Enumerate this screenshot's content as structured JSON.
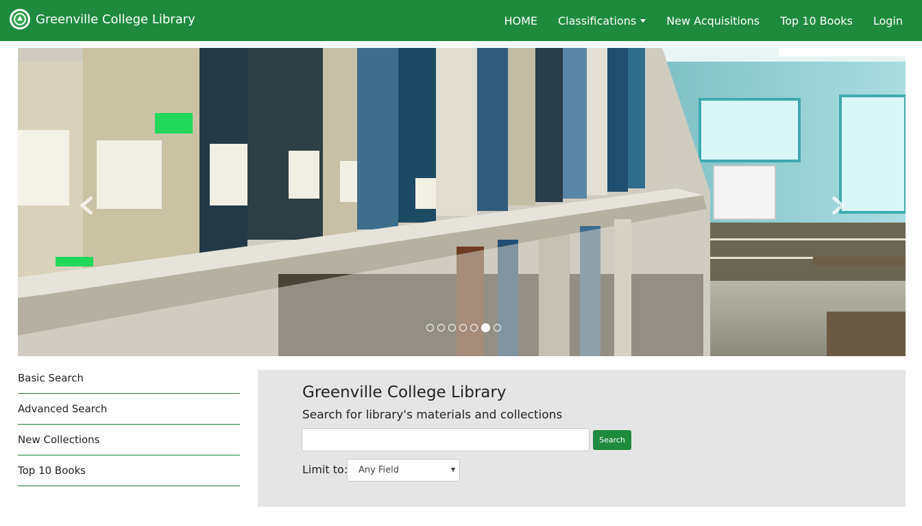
{
  "navbar": {
    "brand": "Greenville College Library",
    "logo_icon": "college-seal-icon",
    "items": [
      {
        "label": "HOME"
      },
      {
        "label": "Classifications",
        "dropdown": true
      },
      {
        "label": "New Acquisitions"
      },
      {
        "label": "Top 10 Books"
      },
      {
        "label": "Login"
      }
    ]
  },
  "carousel": {
    "prev_icon": "chevron-left-icon",
    "next_icon": "chevron-right-icon",
    "slide_count": 7,
    "active_index": 5
  },
  "sidebar": {
    "items": [
      {
        "label": "Basic Search"
      },
      {
        "label": "Advanced Search"
      },
      {
        "label": "New Collections"
      },
      {
        "label": "Top 10 Books"
      }
    ]
  },
  "search": {
    "title": "Greenville College Library",
    "subtitle": "Search for library's materials and collections",
    "input_value": "",
    "button_label": "Search",
    "limit_label": "Limit to:",
    "limit_selected": "Any Field"
  },
  "colors": {
    "brand_green": "#1f8a3e",
    "panel_bg": "#e6e5e5"
  }
}
